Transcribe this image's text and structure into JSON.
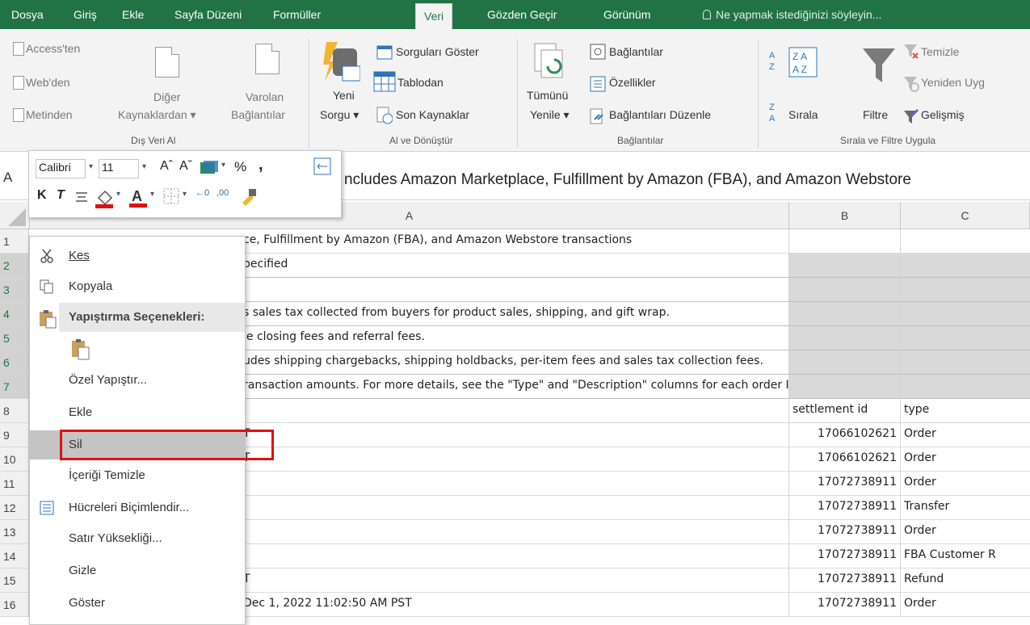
{
  "tabs": [
    {
      "label": "Dosya",
      "active": false
    },
    {
      "label": "Giriş",
      "active": false
    },
    {
      "label": "Ekle",
      "active": false
    },
    {
      "label": "Sayfa Düzeni",
      "active": false
    },
    {
      "label": "Formüller",
      "active": false
    },
    {
      "label": "Veri",
      "active": true
    },
    {
      "label": "Gözden Geçir",
      "active": false
    },
    {
      "label": "Görünüm",
      "active": false
    }
  ],
  "tell_me": "Ne yapmak istediğinizi söyleyin...",
  "ribbon": {
    "dis_veri": {
      "access": "Access'ten",
      "web": "Web'den",
      "metin": "Metinden",
      "diger_1": "Diğer",
      "diger_2": "Kaynaklardan ▾",
      "varolan_1": "Varolan",
      "varolan_2": "Bağlantılar",
      "label": "Dış Veri Al"
    },
    "al_donustur": {
      "yeni_1": "Yeni",
      "yeni_2": "Sorgu ▾",
      "sorgulari": "Sorguları Göster",
      "tablodan": "Tablodan",
      "son": "Son Kaynaklar",
      "label": "Al ve Dönüştür"
    },
    "baglantilar": {
      "tumunu_1": "Tümünü",
      "tumunu_2": "Yenile ▾",
      "baglantilar": "Bağlantılar",
      "ozellikler": "Özellikler",
      "duzenle": "Bağlantıları Düzenle",
      "label": "Bağlantılar"
    },
    "sirala_filtre": {
      "sirala": "Sırala",
      "filtre": "Filtre",
      "temizle": "Temizle",
      "yeniden": "Yeniden Uyg",
      "gelismis": "Gelişmiş",
      "label": "Sırala ve Filtre Uygula"
    }
  },
  "formula_bar": {
    "name_box": "A",
    "formula": "ncludes Amazon Marketplace, Fulfillment by Amazon (FBA), and Amazon Webstore"
  },
  "mini_toolbar": {
    "font": "Calibri",
    "size": "11",
    "bold": "K",
    "italic": "T",
    "percent": "%",
    "comma": ","
  },
  "columns": [
    "A",
    "B",
    "C"
  ],
  "rows": [
    {
      "n": "1",
      "a": "ce, Fulfillment by Amazon (FBA), and Amazon Webstore transactions",
      "b": "",
      "c": "",
      "sel": false
    },
    {
      "n": "2",
      "a": "pecified",
      "b": "",
      "c": "",
      "sel": true
    },
    {
      "n": "3",
      "a": "",
      "b": "",
      "c": "",
      "sel": true
    },
    {
      "n": "4",
      "a": "s sales tax collected from buyers for product sales, shipping, and gift wrap.",
      "b": "",
      "c": "",
      "sel": true
    },
    {
      "n": "5",
      "a": "le closing fees and referral fees.",
      "b": "",
      "c": "",
      "sel": true
    },
    {
      "n": "6",
      "a": "udes shipping chargebacks, shipping holdbacks, per-item fees  and sales tax collection fees.",
      "b": "",
      "c": "",
      "sel": true
    },
    {
      "n": "7",
      "a": "ransaction amounts. For more details, see the \"Type\" and \"Description\" columns for each order ID.",
      "b": "",
      "c": "",
      "sel": true
    },
    {
      "n": "8",
      "a": "",
      "b": "settlement id",
      "c": "type",
      "sel": false
    },
    {
      "n": "9",
      "a": "T",
      "b": "17066102621",
      "c": "Order",
      "sel": false
    },
    {
      "n": "10",
      "a": "T",
      "b": "17066102621",
      "c": "Order",
      "sel": false
    },
    {
      "n": "11",
      "a": "",
      "b": "17072738911",
      "c": "Order",
      "sel": false
    },
    {
      "n": "12",
      "a": "",
      "b": "17072738911",
      "c": "Transfer",
      "sel": false
    },
    {
      "n": "13",
      "a": "",
      "b": "17072738911",
      "c": "Order",
      "sel": false
    },
    {
      "n": "14",
      "a": "",
      "b": "17072738911",
      "c": "FBA Customer R",
      "sel": false
    },
    {
      "n": "15",
      "a": "T",
      "b": "17072738911",
      "c": "Refund",
      "sel": false
    },
    {
      "n": "16",
      "a": "Dec 1, 2022 11:02:50 AM PST",
      "b": "17072738911",
      "c": "Order",
      "sel": false
    }
  ],
  "context_menu": {
    "kes": "Kes",
    "kopyala": "Kopyala",
    "yapistirma": "Yapıştırma Seçenekleri:",
    "ozel": "Özel Yapıştır...",
    "ekle": "Ekle",
    "sil": "Sil",
    "icerigi": "İçeriği Temizle",
    "hucreleri": "Hücreleri Biçimlendir...",
    "satir": "Satır Yüksekliği...",
    "gizle": "Gizle",
    "goster": "Göster"
  }
}
